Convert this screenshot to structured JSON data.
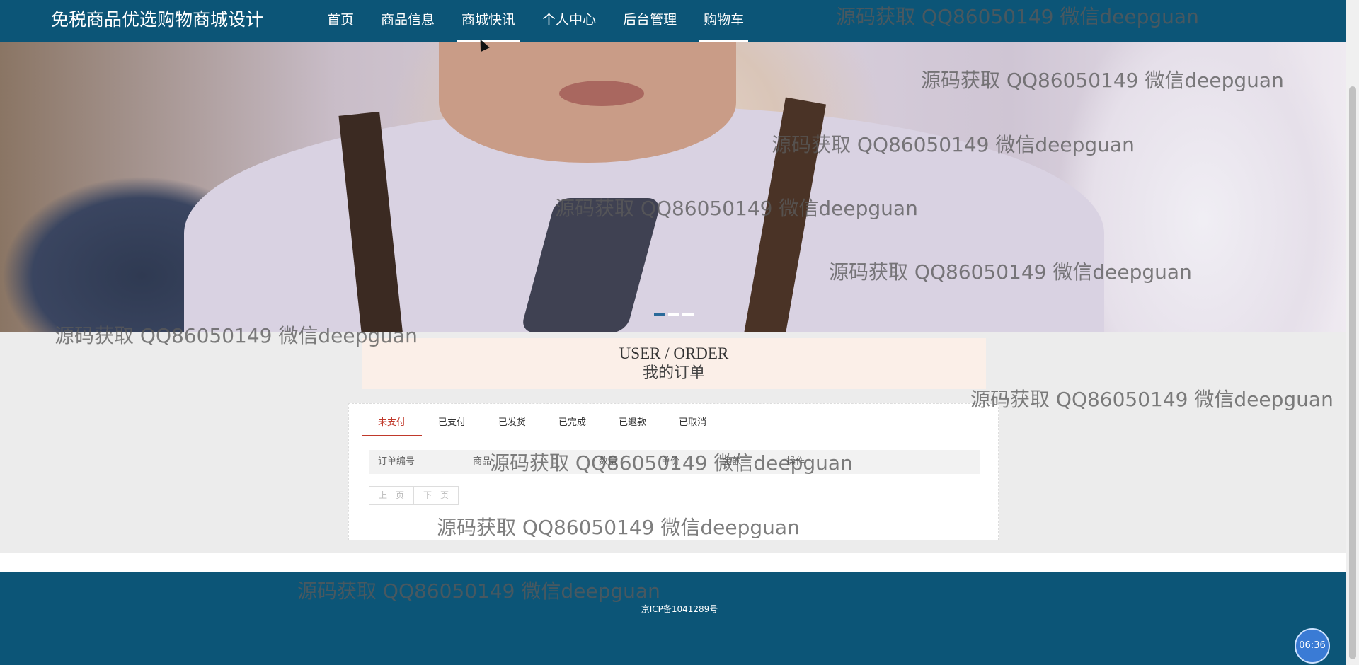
{
  "header": {
    "site_title": "免税商品优选购物商城设计",
    "nav": [
      {
        "label": "首页"
      },
      {
        "label": "商品信息"
      },
      {
        "label": "商城快讯"
      },
      {
        "label": "个人中心"
      },
      {
        "label": "后台管理"
      },
      {
        "label": "购物车"
      }
    ],
    "active_nav": [
      "商城快讯",
      "购物车"
    ]
  },
  "banner": {
    "slides": 3,
    "active_slide": 1
  },
  "section": {
    "title_en": "USER / ORDER",
    "title_cn": "我的订单"
  },
  "orders": {
    "tabs": [
      {
        "label": "未支付"
      },
      {
        "label": "已支付"
      },
      {
        "label": "已发货"
      },
      {
        "label": "已完成"
      },
      {
        "label": "已退款"
      },
      {
        "label": "已取消"
      }
    ],
    "active_tab": "未支付",
    "columns": [
      {
        "label": "订单编号"
      },
      {
        "label": "商品"
      },
      {
        "label": "数量"
      },
      {
        "label": "单价"
      },
      {
        "label": "金额"
      },
      {
        "label": "操作"
      }
    ],
    "pager": {
      "prev": "上一页",
      "next": "下一页"
    }
  },
  "footer": {
    "icp": "京ICP备1041289号"
  },
  "clock": {
    "time": "06:36"
  },
  "watermark": {
    "text": "源码获取 QQ86050149 微信deepguan"
  },
  "colors": {
    "header_bg": "#0c5577",
    "active_tab": "#c0392b",
    "section_bg": "#fbefe8"
  }
}
